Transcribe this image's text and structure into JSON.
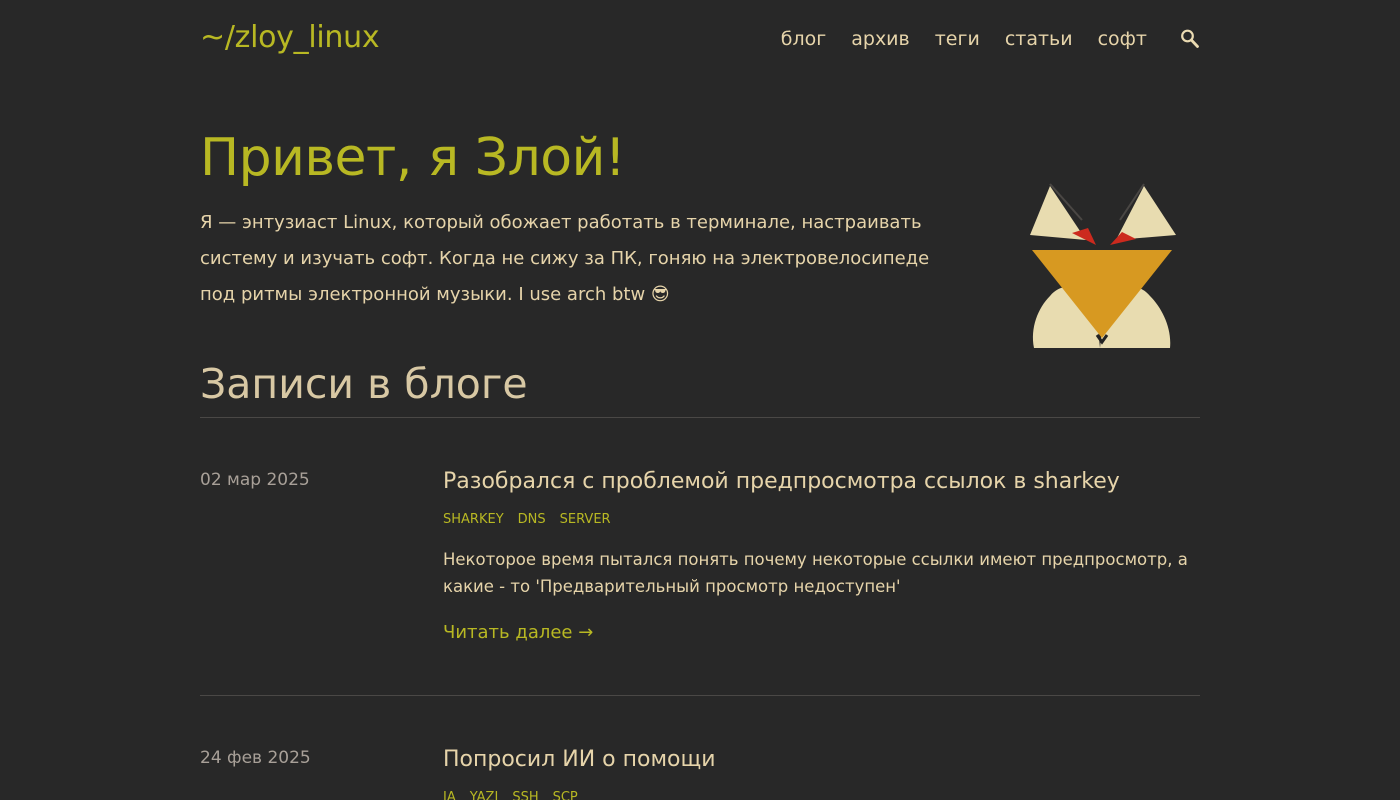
{
  "header": {
    "logo": "~/zloy_linux",
    "nav": [
      "блог",
      "архив",
      "теги",
      "статьи",
      "софт"
    ],
    "search_icon": "search-icon"
  },
  "hero": {
    "title": "Привет, я Злой!",
    "text": "Я — энтузиаст Linux, который обожает работать в терминале, настраивать систему и изучать софт. Когда не сижу за ПК, гоняю на электровелосипеде под ритмы электронной музыки. I use arch btw 😎",
    "avatar_icon": "fox-avatar-icon"
  },
  "blog": {
    "title": "Записи в блоге",
    "posts": [
      {
        "date": "02 мар 2025",
        "title": "Разобрался с проблемой предпросмотра ссылок в sharkey",
        "tags": [
          "sharkey",
          "dns",
          "server"
        ],
        "excerpt": "Некоторое время пытался понять почему некоторые ссылки имеют предпросмотр, а какие - то 'Предварительный просмотр недоступен'",
        "read_more": "Читать далее →"
      },
      {
        "date": "24 фев 2025",
        "title": "Попросил ИИ о помощи",
        "tags": [
          "ia",
          "yazi",
          "ssh",
          "scp"
        ]
      }
    ]
  },
  "colors": {
    "background": "#282828",
    "accent": "#b8b823",
    "text": "#e6d4aa",
    "muted": "#a8a098"
  }
}
